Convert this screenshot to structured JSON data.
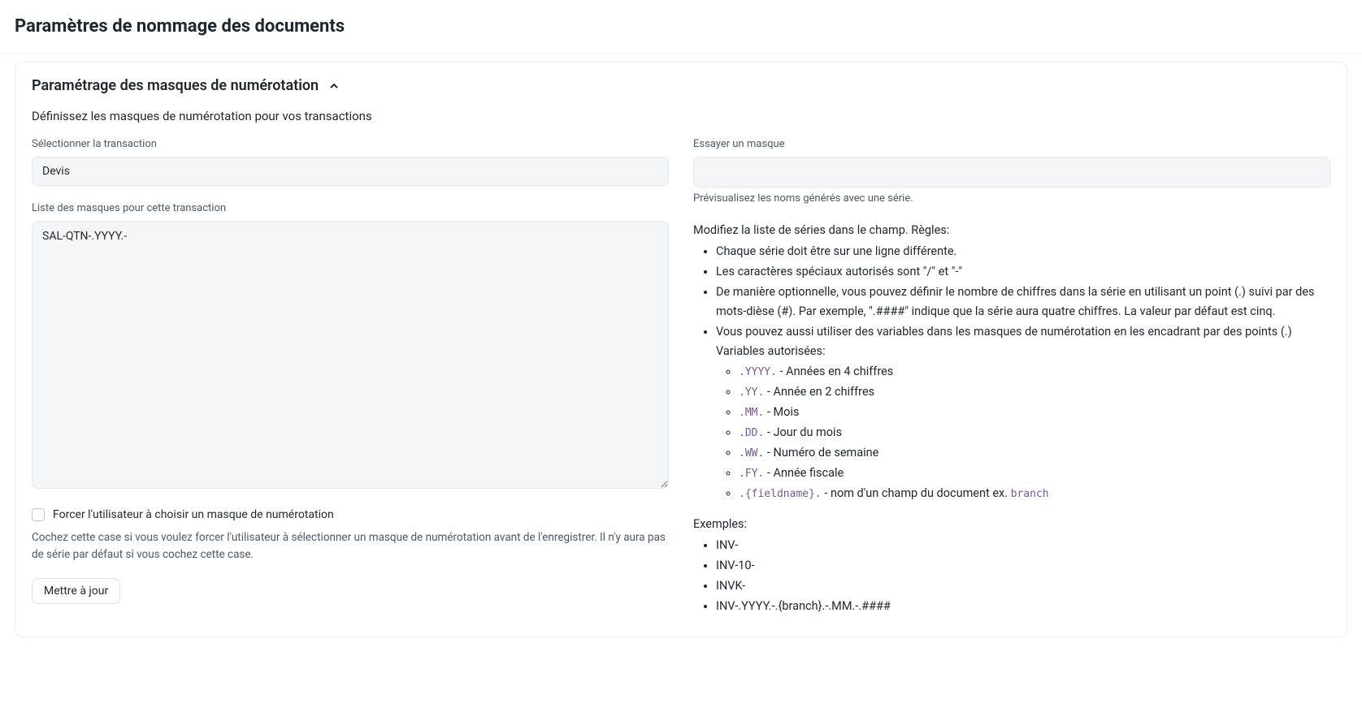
{
  "header": {
    "title": "Paramètres de nommage des documents"
  },
  "section": {
    "title": "Paramétrage des masques de numérotation",
    "subheading": "Définissez les masques de numérotation pour vos transactions"
  },
  "left": {
    "select_label": "Sélectionner la transaction",
    "select_value": "Devis",
    "list_label": "Liste des masques pour cette transaction",
    "list_value": "SAL-QTN-.YYYY.-",
    "checkbox_label": "Forcer l'utilisateur à choisir un masque de numérotation",
    "checkbox_help": "Cochez cette case si vous voulez forcer l'utilisateur à sélectionner un masque de numérotation avant de l'enregistrer. Il n'y aura pas de série par défaut si vous cochez cette case.",
    "update_button": "Mettre à jour"
  },
  "right": {
    "try_label": "Essayer un masque",
    "try_help": "Prévisualisez les noms générés avec une série.",
    "rules_intro": "Modifiez la liste de séries dans le champ. Règles:",
    "rules": [
      "Chaque série doit être sur une ligne différente.",
      "Les caractères spéciaux autorisés sont \"/\" et \"-\"",
      "De manière optionnelle, vous pouvez définir le nombre de chiffres dans la série en utilisant un point (.) suivi par des mots-dièse (#). Par exemple, \".####\" indique que la série aura quatre chiffres. La valeur par défaut est cinq."
    ],
    "rule_vars_intro": "Vous pouvez aussi utiliser des variables dans les masques de numérotation en les encadrant par des points (.)",
    "vars_label": "Variables autorisées:",
    "vars": [
      {
        "code": ".YYYY.",
        "desc": " - Années en 4 chiffres"
      },
      {
        "code": ".YY.",
        "desc": " - Année en 2 chiffres"
      },
      {
        "code": ".MM.",
        "desc": " - Mois"
      },
      {
        "code": ".DD.",
        "desc": " - Jour du mois"
      },
      {
        "code": ".WW.",
        "desc": " - Numéro de semaine"
      },
      {
        "code": ".FY.",
        "desc": " - Année fiscale"
      }
    ],
    "fieldname_code": ".{fieldname}.",
    "fieldname_desc": " - nom d'un champ du document ex. ",
    "fieldname_example": "branch",
    "examples_label": "Exemples:",
    "examples": [
      "INV-",
      "INV-10-",
      "INVK-",
      "INV-.YYYY.-.{branch}.-.MM.-.####"
    ]
  }
}
